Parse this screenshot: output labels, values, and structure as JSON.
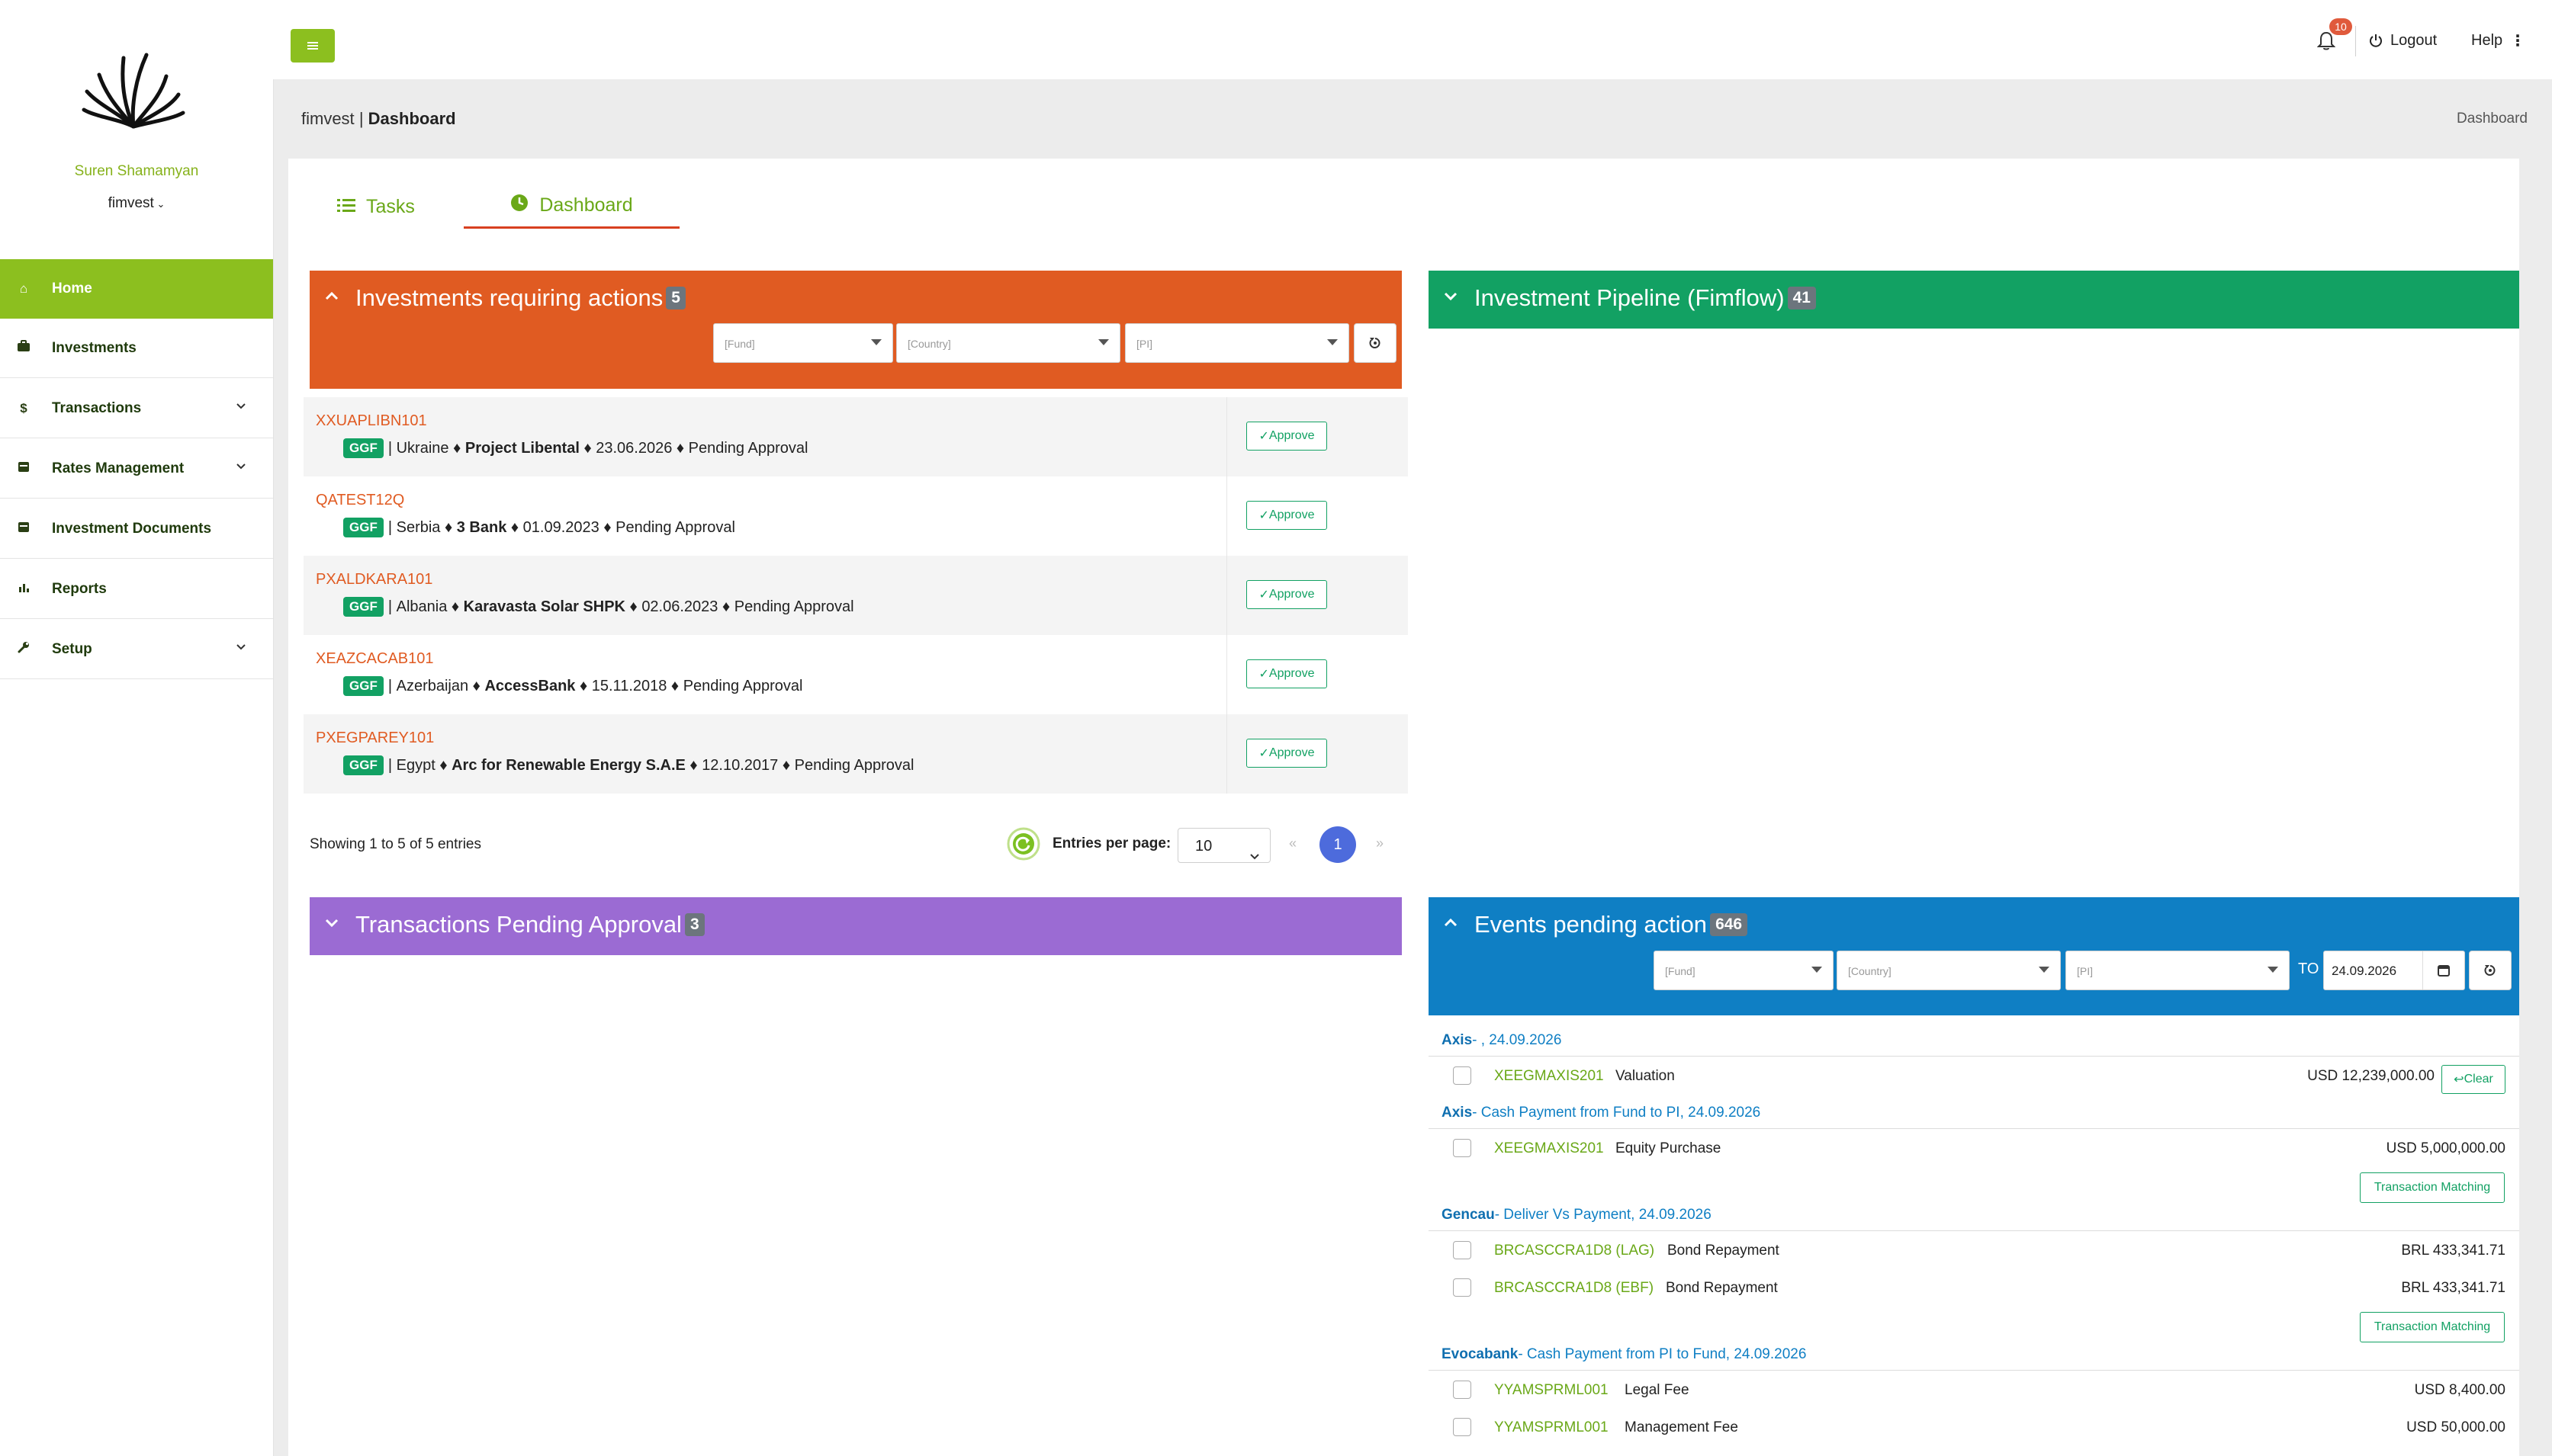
{
  "sidebar": {
    "user_name": "Suren Shamamyan",
    "org": "fimvest",
    "items": [
      {
        "label": "Home",
        "icon": "home-icon"
      },
      {
        "label": "Investments",
        "icon": "briefcase-icon"
      },
      {
        "label": "Transactions",
        "icon": "dollar-icon"
      },
      {
        "label": "Rates Management",
        "icon": "calendar-icon"
      },
      {
        "label": "Investment Documents",
        "icon": "document-icon"
      },
      {
        "label": "Reports",
        "icon": "chart-icon"
      },
      {
        "label": "Setup",
        "icon": "wrench-icon"
      }
    ]
  },
  "topbar": {
    "notification_count": "10",
    "logout_label": "Logout",
    "help_label": "Help"
  },
  "breadcrumb": {
    "app": "fimvest",
    "separator": "|",
    "page": "Dashboard",
    "right": "Dashboard"
  },
  "tabs": [
    {
      "label": "Tasks"
    },
    {
      "label": "Dashboard"
    }
  ],
  "investments_panel": {
    "title": "Investments requiring actions",
    "count": "5",
    "filters": {
      "fund": "[Fund]",
      "country": "[Country]",
      "pi": "[PI]"
    },
    "rows": [
      {
        "code": "XXUAPLIBN101",
        "badge": "GGF",
        "country": "Ukraine",
        "project": "Project Libental",
        "date": "23.06.2026",
        "status": "Pending Approval"
      },
      {
        "code": "QATEST12Q",
        "badge": "GGF",
        "country": "Serbia",
        "project": "3 Bank",
        "date": "01.09.2023",
        "status": "Pending Approval"
      },
      {
        "code": "PXALDKARA101",
        "badge": "GGF",
        "country": "Albania",
        "project": "Karavasta Solar SHPK",
        "date": "02.06.2023",
        "status": "Pending Approval"
      },
      {
        "code": "XEAZCACAB101",
        "badge": "GGF",
        "country": "Azerbaijan",
        "project": "AccessBank",
        "date": "15.11.2018",
        "status": "Pending Approval"
      },
      {
        "code": "PXEGPAREY101",
        "badge": "GGF",
        "country": "Egypt",
        "project": "Arc for Renewable Energy S.A.E",
        "date": "12.10.2017",
        "status": "Pending Approval"
      }
    ],
    "approve_label": "Approve",
    "showing": "Showing 1 to 5 of 5 entries",
    "entries_label": "Entries per page:",
    "entries_value": "10",
    "page": "1"
  },
  "pipeline_panel": {
    "title": "Investment Pipeline (Fimflow)",
    "count": "41"
  },
  "transactions_panel": {
    "title": "Transactions Pending Approval",
    "count": "3"
  },
  "events_panel": {
    "title": "Events pending action",
    "count": "646",
    "filters": {
      "fund": "[Fund]",
      "country": "[Country]",
      "pi": "[PI]"
    },
    "to_label": "TO",
    "date": "24.09.2026",
    "groups": [
      {
        "entity": "Axis",
        "desc": "- , 24.09.2026",
        "items": [
          {
            "code": "XEEGMAXIS201",
            "type": "Valuation",
            "amount": "USD 12,239,000.00"
          }
        ]
      },
      {
        "entity": "Axis",
        "desc": "- Cash Payment from Fund to PI, 24.09.2026",
        "items": [
          {
            "code": "XEEGMAXIS201",
            "type": "Equity Purchase",
            "amount": "USD 5,000,000.00"
          }
        ]
      },
      {
        "entity": "Gencau",
        "desc": "- Deliver Vs Payment, 24.09.2026",
        "items": [
          {
            "code": "BRCASCCRA1D8 (LAG)",
            "type": "Bond Repayment",
            "amount": "BRL 433,341.71"
          },
          {
            "code": "BRCASCCRA1D8 (EBF)",
            "type": "Bond Repayment",
            "amount": "BRL 433,341.71"
          }
        ]
      },
      {
        "entity": "Evocabank",
        "desc": "- Cash Payment from PI to Fund, 24.09.2026",
        "items": [
          {
            "code": "YYAMSPRML001",
            "type": "Legal Fee",
            "amount": "USD 8,400.00"
          },
          {
            "code": "YYAMSPRML001",
            "type": "Management Fee",
            "amount": "USD 50,000.00"
          }
        ]
      }
    ],
    "clear_label": "Clear",
    "match_label": "Transaction Matching"
  },
  "colors": {
    "accent_green": "#8cbf1f",
    "orange": "#e05b22",
    "teal_green": "#12a163",
    "purple": "#9b6bd3",
    "blue": "#0f7fc4"
  }
}
